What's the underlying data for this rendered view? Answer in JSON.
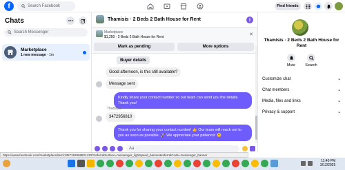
{
  "topbar": {
    "logo": "f",
    "search_placeholder": "Search Facebook",
    "find_friends": "Find friends"
  },
  "sidebar": {
    "title": "Chats",
    "search_placeholder": "Search Messenger",
    "items": [
      {
        "title": "Marketplace",
        "subtitle_bold": "1 new message",
        "subtitle_rest": " · 1m"
      }
    ]
  },
  "conversation": {
    "title": "Thamisis · 2 Beds 2 Bath House for Rent",
    "listing": {
      "label": "Marketplace",
      "text": "$1,250 · 2 Beds 2 Bath House for Rent",
      "mark_pending": "Mark as pending",
      "more_options": "More options"
    },
    "buyer_details": "Buyer details",
    "messages": [
      {
        "side": "in",
        "text": "Good afternoon, is this still available?"
      },
      {
        "side": "in",
        "text": "Message sent"
      },
      {
        "side": "out",
        "text": "Kindly share your contact number so our team can send you the details. Thank you!"
      },
      {
        "side": "in",
        "sender": "Thamisis",
        "text": "3472956810"
      },
      {
        "side": "out",
        "text": "Thank you for sharing your contact number! 👍 Our team will reach out to you as soon as possible. 🚀 We appreciate your patience! 😊"
      }
    ],
    "composer_placeholder": "Aa"
  },
  "info_panel": {
    "title": "Thamisis · 2 Beds 2 Bath House for Rent",
    "actions": [
      {
        "label": "Mute"
      },
      {
        "label": "Search"
      }
    ],
    "rows": [
      {
        "label": "Customize chat"
      },
      {
        "label": "Chat members"
      },
      {
        "label": "Media, files and links"
      },
      {
        "label": "Privacy & support"
      }
    ]
  },
  "status_url": "https://www.facebook.com/marketplace/item/1357152968821433/?referralSurface=messenger_lightspeed_banner&referralCode=messenger_banner",
  "taskbar": {
    "time": "11:40 PM",
    "date": "3/12/2025"
  },
  "colors": {
    "brand": "#0866ff",
    "outgoing_bubble": "#6e5dfc",
    "accent_purple": "#7b57e8"
  }
}
